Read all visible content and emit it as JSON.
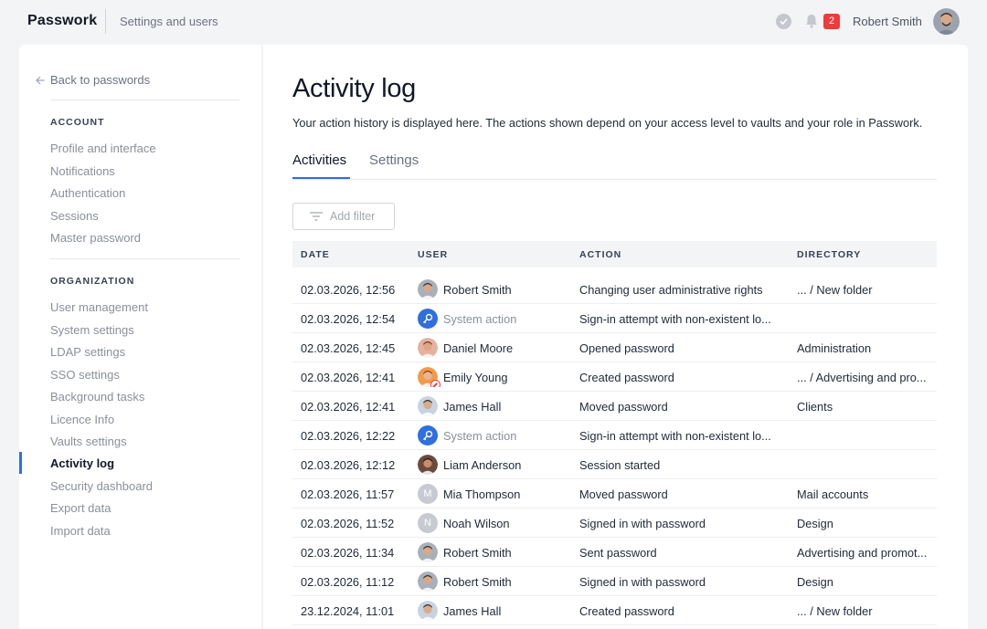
{
  "header": {
    "brand": "Passwork",
    "breadcrumb": "Settings and users",
    "notification_count": "2",
    "user_name": "Robert Smith"
  },
  "sidebar": {
    "back_label": "Back to passwords",
    "account_heading": "ACCOUNT",
    "account_items": [
      "Profile and interface",
      "Notifications",
      "Authentication",
      "Sessions",
      "Master password"
    ],
    "org_heading": "ORGANIZATION",
    "org_items": [
      "User management",
      "System settings",
      "LDAP settings",
      "SSO settings",
      "Background tasks",
      "Licence Info",
      "Vaults settings",
      "Activity log",
      "Security dashboard",
      "Export data",
      "Import data"
    ],
    "active_item": "Activity log"
  },
  "main": {
    "title": "Activity log",
    "description": "Your action history is displayed here. The actions shown depend on your access level to vaults and your role in Passwork.",
    "tabs": [
      {
        "label": "Activities"
      },
      {
        "label": "Settings"
      }
    ],
    "filter_label": "Add filter",
    "columns": {
      "date": "DATE",
      "user": "USER",
      "action": "ACTION",
      "directory": "DIRECTORY"
    },
    "rows": [
      {
        "date": "02.03.2026, 12:56",
        "user": "Robert Smith",
        "avatar": "photo-robert",
        "action": "Changing user administrative rights",
        "directory": "... / New folder"
      },
      {
        "date": "02.03.2026, 12:54",
        "user": "System action",
        "avatar": "system",
        "action": "Sign-in attempt with non-existent lo...",
        "directory": ""
      },
      {
        "date": "02.03.2026, 12:45",
        "user": "Daniel Moore",
        "avatar": "photo-daniel",
        "action": "Opened password",
        "directory": "Administration"
      },
      {
        "date": "02.03.2026, 12:41",
        "user": "Emily Young",
        "avatar": "photo-emily",
        "action": "Created password",
        "directory": "... / Advertising and pro..."
      },
      {
        "date": "02.03.2026, 12:41",
        "user": "James Hall",
        "avatar": "photo-james",
        "action": "Moved password",
        "directory": "Clients"
      },
      {
        "date": "02.03.2026, 12:22",
        "user": "System action",
        "avatar": "system",
        "action": "Sign-in attempt with non-existent lo...",
        "directory": ""
      },
      {
        "date": "02.03.2026, 12:12",
        "user": "Liam Anderson",
        "avatar": "photo-liam",
        "action": "Session started",
        "directory": ""
      },
      {
        "date": "02.03.2026, 11:57",
        "user": "Mia Thompson",
        "avatar": "letter",
        "initial": "M",
        "action": "Moved password",
        "directory": "Mail accounts"
      },
      {
        "date": "02.03.2026, 11:52",
        "user": "Noah Wilson",
        "avatar": "letter",
        "initial": "N",
        "action": "Signed in with password",
        "directory": "Design"
      },
      {
        "date": "02.03.2026, 11:34",
        "user": "Robert Smith",
        "avatar": "photo-robert",
        "action": "Sent password",
        "directory": "Advertising and promot..."
      },
      {
        "date": "02.03.2026, 11:12",
        "user": "Robert Smith",
        "avatar": "photo-robert",
        "action": "Signed in with password",
        "directory": "Design"
      },
      {
        "date": "23.12.2024, 11:01",
        "user": "James Hall",
        "avatar": "photo-james",
        "action": "Created password",
        "directory": "... / New folder"
      }
    ]
  },
  "colors": {
    "accent": "#2f6fde",
    "badge": "#ef3b3b"
  }
}
